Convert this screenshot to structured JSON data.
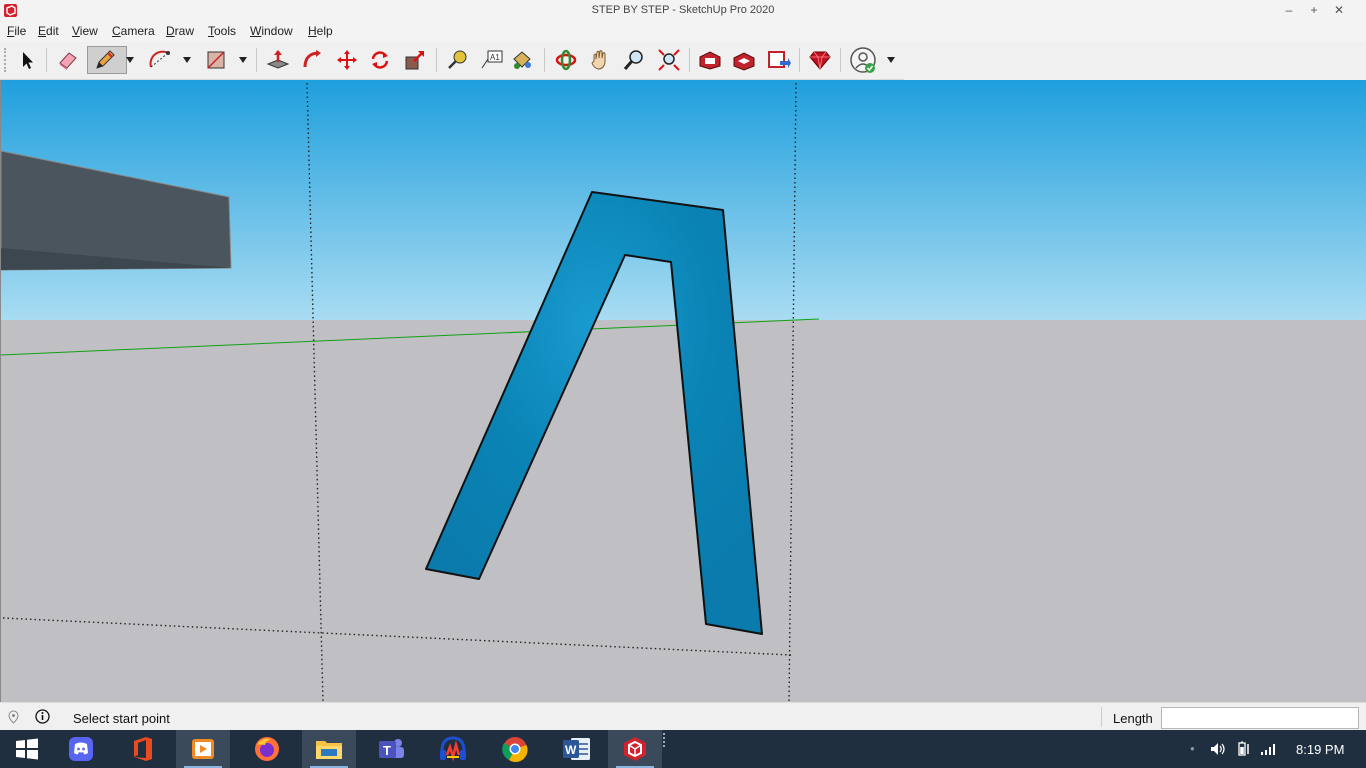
{
  "window": {
    "title": "STEP BY STEP - SketchUp Pro 2020",
    "minimize_glyph": "–",
    "maximize_glyph": "+",
    "close_glyph": "✕"
  },
  "menu": [
    {
      "underline": "F",
      "rest": "ile"
    },
    {
      "underline": "E",
      "rest": "dit"
    },
    {
      "underline": "V",
      "rest": "iew"
    },
    {
      "underline": "C",
      "rest": "amera"
    },
    {
      "underline": "D",
      "rest": "raw"
    },
    {
      "underline": "T",
      "rest": "ools"
    },
    {
      "underline": "W",
      "rest": "indow"
    },
    {
      "underline": "H",
      "rest": "elp"
    }
  ],
  "toolbar": {
    "tools": [
      "select-icon",
      "eraser-icon",
      "pencil-icon",
      "arc-icon",
      "rectangle-icon",
      "push-pull-icon",
      "follow-me-icon",
      "move-icon",
      "rotate-icon",
      "scale-icon",
      "tape-measure-icon",
      "text-icon",
      "paint-bucket-icon",
      "orbit-icon",
      "pan-icon",
      "zoom-icon",
      "zoom-extents-icon",
      "warehouse-icon",
      "share-model-icon",
      "extension-warehouse-icon",
      "ruby-icon",
      "account-icon"
    ],
    "active_tool": "pencil-icon"
  },
  "status": {
    "message": "Select start point",
    "vcb_label": "Length",
    "vcb_value": ""
  },
  "taskbar": {
    "apps": [
      "start-icon",
      "discord-icon",
      "office-icon",
      "media-player-icon",
      "firefox-icon",
      "file-explorer-icon",
      "teams-icon",
      "audio-app-icon",
      "chrome-icon",
      "word-icon",
      "sketchup-icon"
    ],
    "active_app": "sketchup-icon",
    "teams_letter": "T",
    "word_letter": "W",
    "clock": "8:19 PM"
  },
  "colors": {
    "sky_top": "#1f9fdd",
    "sky_bottom": "#a9dcf2",
    "ground": "#c0c0c4",
    "shape_fill": "#0a84b5",
    "axis_green": "#11a011",
    "taskbar": "#1f2f3f"
  }
}
